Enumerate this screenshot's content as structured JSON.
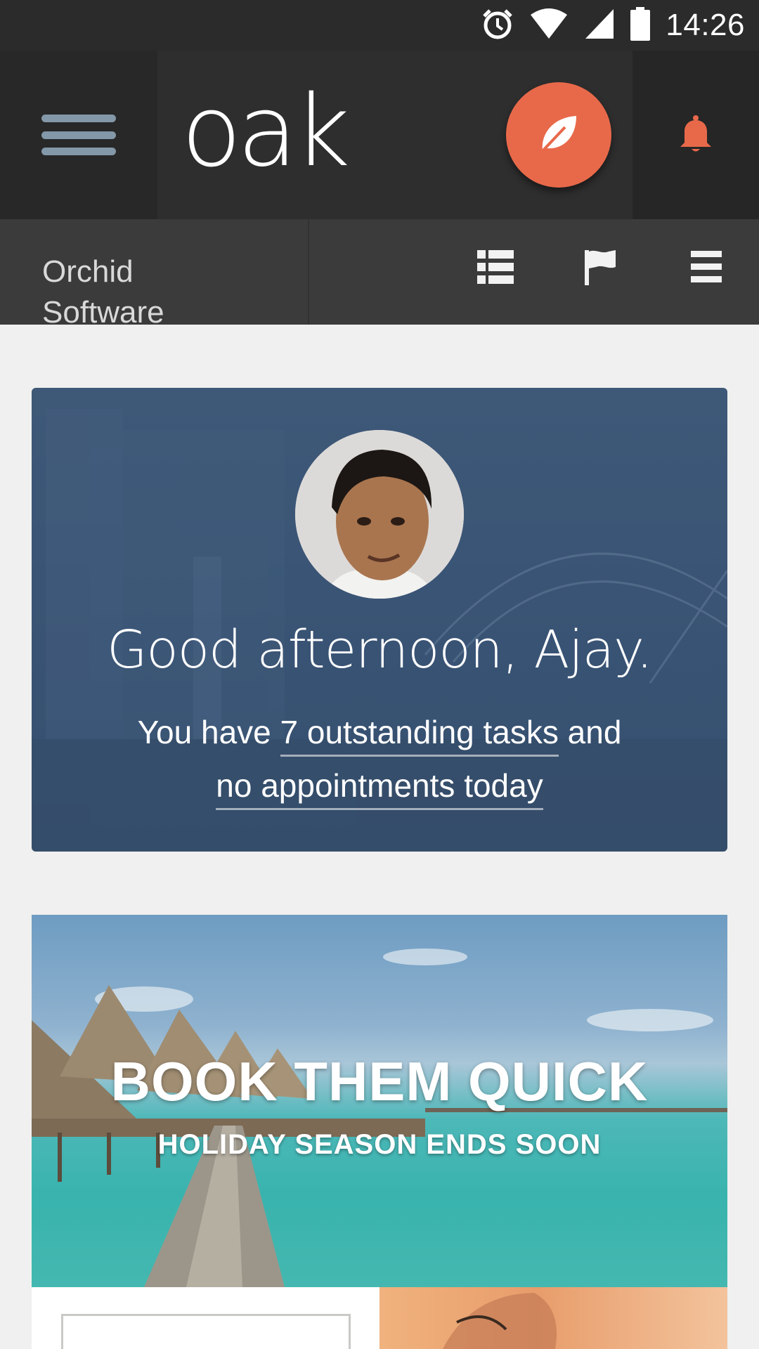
{
  "status_bar": {
    "time": "14:26",
    "icons": [
      "alarm-icon",
      "wifi-icon",
      "signal-icon",
      "battery-icon"
    ]
  },
  "app_bar": {
    "logo": "oak",
    "menu_icon": "hamburger-menu-icon",
    "action_icon": "leaf-icon",
    "notification_icon": "bell-icon",
    "accent_color": "#e8694a"
  },
  "sub_bar": {
    "organization": "Orchid Software",
    "icons": [
      "list-view-icon",
      "flag-icon",
      "menu-lines-icon"
    ]
  },
  "greeting_card": {
    "greeting": "Good afternoon, Ajay.",
    "summary_prefix": "You have ",
    "tasks_link": "7 outstanding tasks",
    "summary_middle": " and",
    "appointments_link": "no appointments today"
  },
  "promo": {
    "title": "BOOK THEM QUICK",
    "subtitle": "HOLIDAY SEASON ENDS SOON"
  }
}
